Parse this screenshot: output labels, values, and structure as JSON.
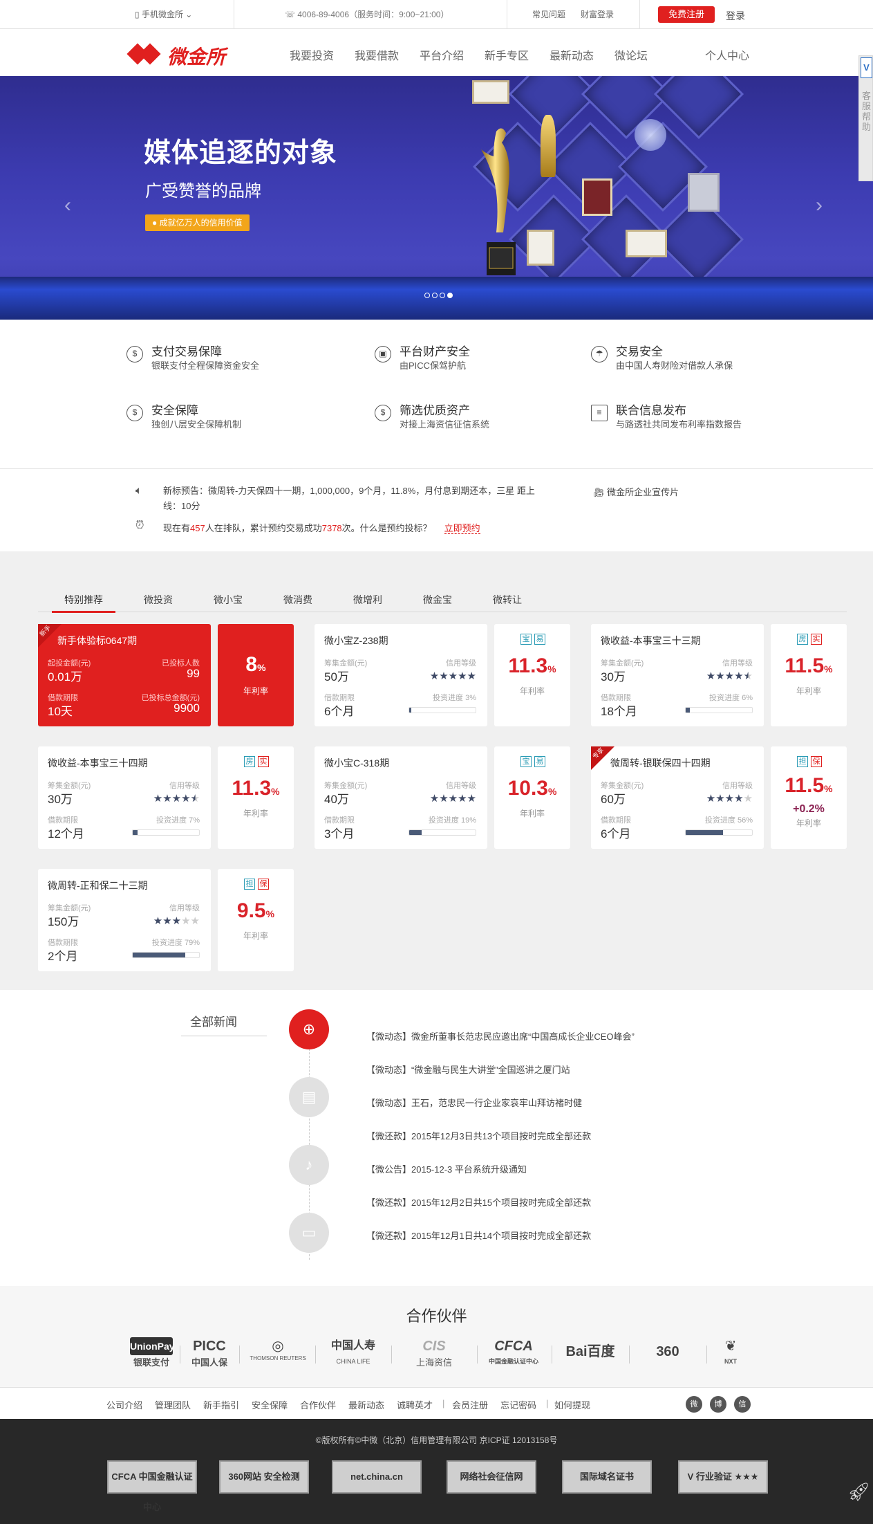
{
  "topbar": {
    "mobile": "手机微金所",
    "phone": "4006-89-4006（服务时间：9:00~21:00）",
    "faq": "常见问题",
    "wealth_login": "财富登录",
    "register": "免费注册",
    "login": "登录"
  },
  "nav": {
    "logo": "微金所",
    "items": [
      "我要投资",
      "我要借款",
      "平台介绍",
      "新手专区",
      "最新动态",
      "微论坛"
    ],
    "account": "个人中心"
  },
  "sidefloat": {
    "icon": "V",
    "label": "客服帮助"
  },
  "banner": {
    "title": "媒体追逐的对象",
    "subtitle": "广受赞誉的品牌",
    "badge": "● 成就亿万人的信用价值",
    "prev": "‹",
    "next": "›"
  },
  "features": [
    {
      "icon": "$",
      "title": "支付交易保障",
      "desc": "银联支付全程保障资金安全"
    },
    {
      "icon": "▣",
      "title": "平台财产安全",
      "desc": "由PICC保驾护航"
    },
    {
      "icon": "☂",
      "title": "交易安全",
      "desc": "由中国人寿财险对借款人承保"
    },
    {
      "icon": "$",
      "title": "安全保障",
      "desc": "独创八层安全保障机制"
    },
    {
      "icon": "$",
      "title": "筛选优质资产",
      "desc": "对接上海资信征信系统"
    },
    {
      "icon": "≡",
      "title": "联合信息发布",
      "desc": "与路透社共同发布利率指数报告"
    }
  ],
  "notice": {
    "preview": "新标预告：微周转-力天保四十一期，1,000,000，9个月，11.8%，月付息到期还本，三星 距上线：10分",
    "queue_prefix": "现在有",
    "queue_count": "457",
    "queue_mid": "人在排队，累计预约交易成功",
    "queue_total": "7378",
    "queue_suffix": "次。什么是预约投标？",
    "queue_link": "立即预约",
    "video": "微金所企业宣传片"
  },
  "products": {
    "tabs": [
      "特别推荐",
      "微投资",
      "微小宝",
      "微消费",
      "微增利",
      "微金宝",
      "微转让"
    ],
    "cards": [
      {
        "name": "新手体验标0647期",
        "l1": "起投金额(元)",
        "v1": "0.01万",
        "l2": "已投标人数",
        "v2": "99",
        "l3": "借款期限",
        "v3": "10天",
        "l4": "已投标总金额(元)",
        "v4": "9900",
        "rate": "8",
        "unit": "%",
        "rlabel": "年利率",
        "corner": "新手"
      },
      {
        "name": "微小宝Z-238期",
        "l1": "筹集金额(元)",
        "v1": "50万",
        "l2": "信用等级",
        "stars": 5,
        "l3": "借款期限",
        "v3": "6个月",
        "l4": "投资进度",
        "progress": 3,
        "rate": "11.3",
        "unit": "%",
        "rlabel": "年利率",
        "tags": [
          "宝",
          "易"
        ],
        "tagcolors": [
          "#2a9bb5",
          "#2a9bb5"
        ]
      },
      {
        "name": "微收益-本事宝三十三期",
        "l1": "筹集金额(元)",
        "v1": "30万",
        "l2": "信用等级",
        "stars": 4.5,
        "l3": "借款期限",
        "v3": "18个月",
        "l4": "投资进度",
        "progress": 6,
        "rate": "11.5",
        "unit": "%",
        "rlabel": "年利率",
        "tags": [
          "房",
          "实"
        ],
        "tagcolors": [
          "#2a9bb5",
          "#e0201f"
        ]
      },
      {
        "name": "微收益-本事宝三十四期",
        "l1": "筹集金额(元)",
        "v1": "30万",
        "l2": "信用等级",
        "stars": 4.5,
        "l3": "借款期限",
        "v3": "12个月",
        "l4": "投资进度",
        "progress": 7,
        "rate": "11.3",
        "unit": "%",
        "rlabel": "年利率",
        "tags": [
          "房",
          "实"
        ],
        "tagcolors": [
          "#2a9bb5",
          "#e0201f"
        ]
      },
      {
        "name": "微小宝C-318期",
        "l1": "筹集金额(元)",
        "v1": "40万",
        "l2": "信用等级",
        "stars": 5,
        "l3": "借款期限",
        "v3": "3个月",
        "l4": "投资进度",
        "progress": 19,
        "rate": "10.3",
        "unit": "%",
        "rlabel": "年利率",
        "tags": [
          "宝",
          "易"
        ],
        "tagcolors": [
          "#2a9bb5",
          "#2a9bb5"
        ]
      },
      {
        "name": "微周转-银联保四十四期",
        "l1": "筹集金额(元)",
        "v1": "60万",
        "l2": "信用等级",
        "stars": 4,
        "l3": "借款期限",
        "v3": "6个月",
        "l4": "投资进度",
        "progress": 56,
        "rate": "11.5",
        "unit": "%",
        "plus": "+0.2%",
        "rlabel": "年利率",
        "tags": [
          "担",
          "保"
        ],
        "tagcolors": [
          "#2a9bb5",
          "#e0201f"
        ],
        "corner": "专享"
      },
      {
        "name": "微周转-正和保二十三期",
        "l1": "筹集金额(元)",
        "v1": "150万",
        "l2": "信用等级",
        "stars": 3,
        "l3": "借款期限",
        "v3": "2个月",
        "l4": "投资进度",
        "progress": 79,
        "rate": "9.5",
        "unit": "%",
        "rlabel": "年利率",
        "tags": [
          "担",
          "保"
        ],
        "tagcolors": [
          "#2a9bb5",
          "#e0201f"
        ]
      }
    ]
  },
  "news": {
    "title": "全部新闻",
    "items": [
      "【微动态】微金所董事长范忠民应邀出席“中国高成长企业CEO峰会”",
      "【微动态】“微金融与民生大讲堂”全国巡讲之厦门站",
      "【微动态】王石，范忠民一行企业家哀牢山拜访褚时健",
      "【微还款】2015年12月3日共13个项目按时完成全部还款",
      "【微公告】2015-12-3 平台系统升级通知",
      "【微还款】2015年12月2日共15个项目按时完成全部还款",
      "【微还款】2015年12月1日共14个项目按时完成全部还款"
    ]
  },
  "partners": {
    "title": "合作伙伴",
    "logos": [
      {
        "big": "UnionPay",
        "small": "银联支付"
      },
      {
        "big": "PICC",
        "small": "中国人保"
      },
      {
        "big": "◎",
        "small": "THOMSON REUTERS"
      },
      {
        "big": "中国人寿",
        "small": "CHINA LIFE"
      },
      {
        "big": "CIS",
        "small": "上海资信"
      },
      {
        "big": "CFCA",
        "small": "中国金融认证中心"
      },
      {
        "big": "Bai百度",
        "small": ""
      },
      {
        "big": "360",
        "small": ""
      },
      {
        "big": "❦",
        "small": "NXT"
      }
    ]
  },
  "footer": {
    "links": [
      "公司介绍",
      "管理团队",
      "新手指引",
      "安全保障",
      "合作伙伴",
      "最新动态",
      "诚聘英才",
      "|",
      "会员注册",
      "忘记密码",
      "|",
      "如何提现"
    ],
    "copyright": "©版权所有©中微（北京）信用管理有限公司 京ICP证 12013158号",
    "certs": [
      "CFCA 中国金融认证中心",
      "360网站 安全检测",
      "net.china.cn",
      "网络社会征信网",
      "国际域名证书",
      "V 行业验证 ★★★"
    ],
    "social": [
      "微",
      "博",
      "信"
    ]
  }
}
